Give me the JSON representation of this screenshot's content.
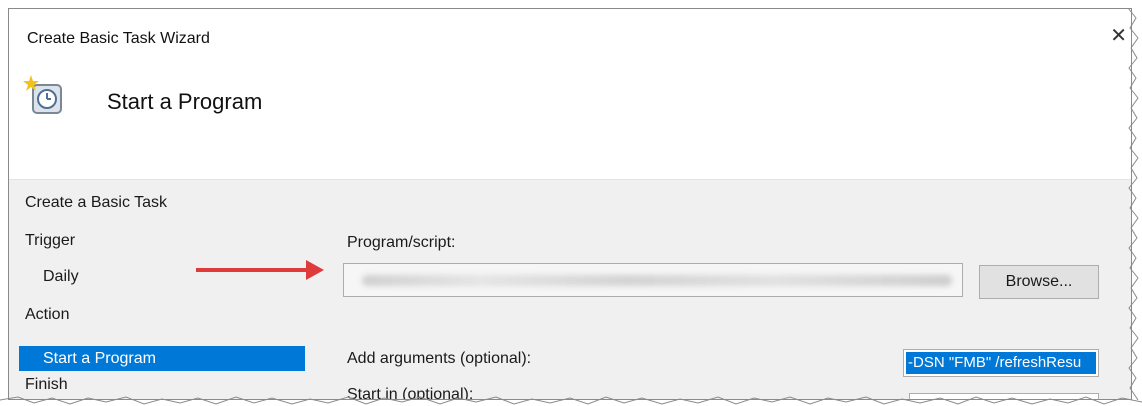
{
  "window": {
    "title": "Create Basic Task Wizard",
    "close_glyph": "✕"
  },
  "header": {
    "title": "Start a Program"
  },
  "sidebar": {
    "section_title": "Create a Basic Task",
    "items": [
      {
        "label": "Trigger"
      },
      {
        "label": "Daily"
      },
      {
        "label": "Action"
      },
      {
        "label": "Start a Program"
      },
      {
        "label": "Finish"
      }
    ]
  },
  "form": {
    "program_label": "Program/script:",
    "program_value_visible": "",
    "browse_label": "Browse...",
    "arguments_label": "Add arguments (optional):",
    "arguments_value": "-DSN \"FMB\" /refreshResu",
    "start_in_label": "Start in (optional):",
    "start_in_value": ""
  },
  "colors": {
    "accent": "#0078d7",
    "arrow": "#e03b3b"
  },
  "icons": {
    "header_icon": "task-clock-icon"
  }
}
